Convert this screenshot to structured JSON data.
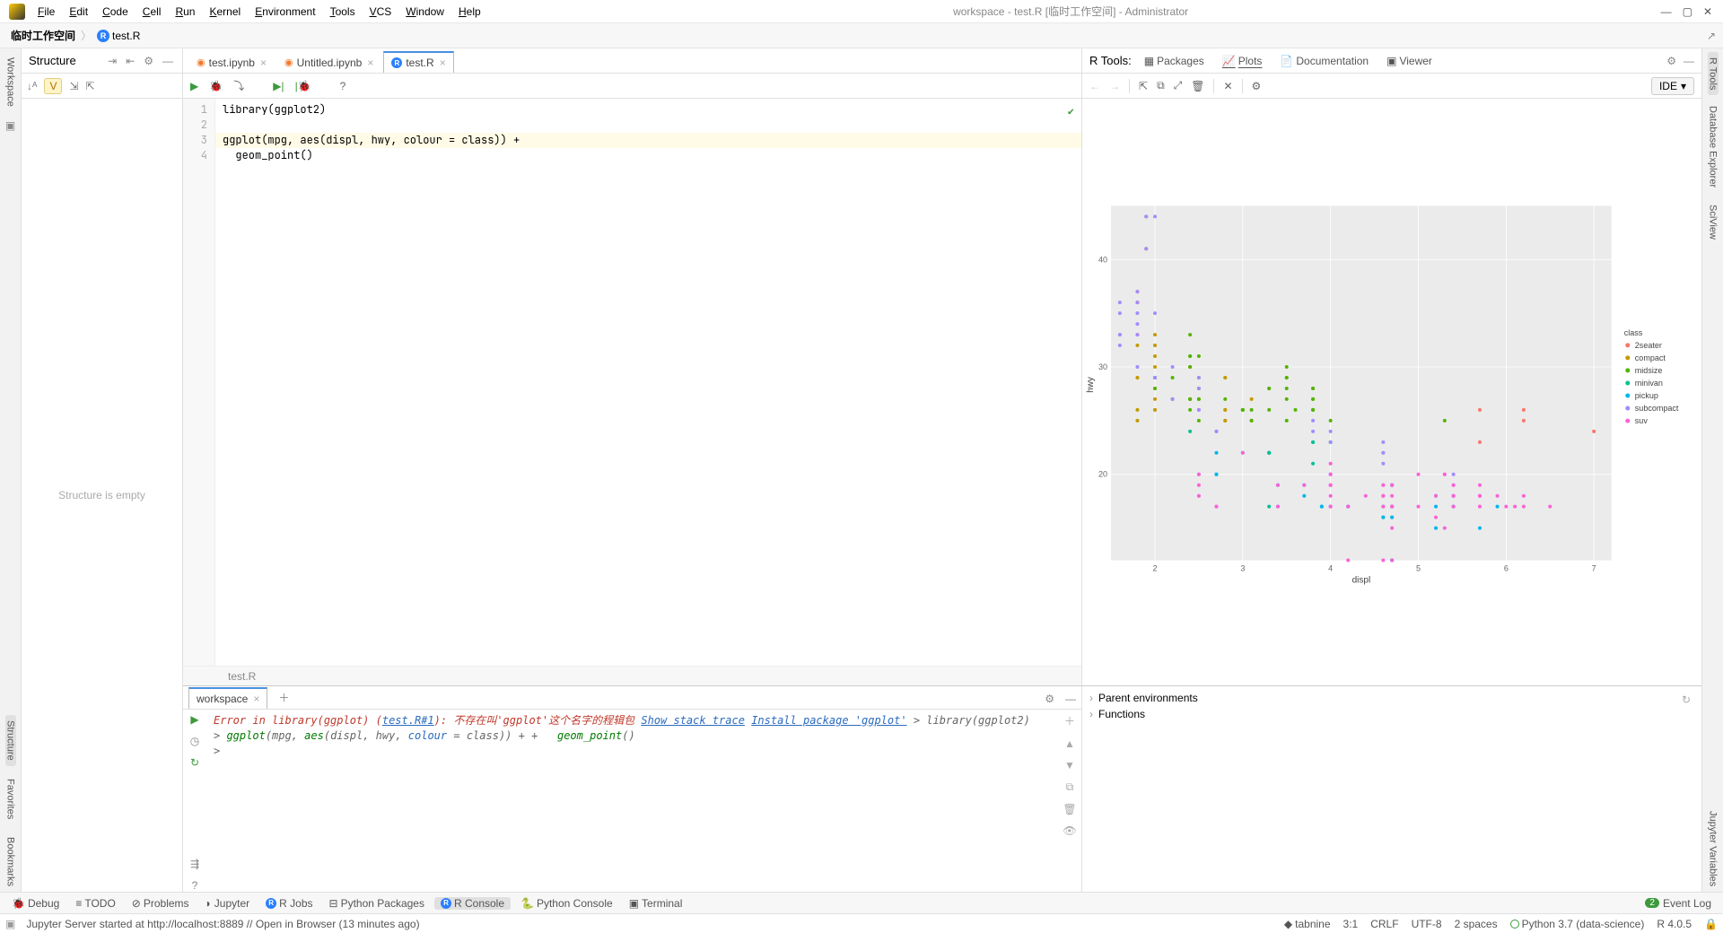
{
  "menus": [
    "File",
    "Edit",
    "Code",
    "Cell",
    "Run",
    "Kernel",
    "Environment",
    "Tools",
    "VCS",
    "Window",
    "Help"
  ],
  "window_title": "workspace - test.R [临时工作空间] - Administrator",
  "breadcrumb": {
    "root": "临时工作空间",
    "file": "test.R"
  },
  "structure": {
    "title": "Structure",
    "empty": "Structure is empty"
  },
  "left_tabs": {
    "workspace": "Workspace",
    "structure": "Structure",
    "favorites": "Favorites",
    "bookmarks": "Bookmarks"
  },
  "right_tabs": {
    "rtools": "R Tools",
    "db": "Database Explorer",
    "sciview": "SciView",
    "jupvars": "Jupyter Variables"
  },
  "editor_tabs": [
    {
      "label": "test.ipynb",
      "type": "jup"
    },
    {
      "label": "Untitled.ipynb",
      "type": "jup"
    },
    {
      "label": "test.R",
      "type": "r",
      "active": true
    }
  ],
  "code": {
    "l1": "library(ggplot2)",
    "l3": "ggplot(mpg, aes(displ, hwy, colour = class)) +",
    "l4": "  geom_point()"
  },
  "editor_path": "test.R",
  "rtools": {
    "label": "R Tools:",
    "tabs": [
      "Packages",
      "Plots",
      "Documentation",
      "Viewer"
    ],
    "ide": "IDE"
  },
  "chart_data": {
    "type": "scatter",
    "xlabel": "displ",
    "ylabel": "hwy",
    "xrange": [
      1.5,
      7.2
    ],
    "yrange": [
      12,
      45
    ],
    "xticks": [
      2,
      3,
      4,
      5,
      6,
      7
    ],
    "yticks": [
      20,
      30,
      40
    ],
    "legend_title": "class",
    "series": [
      {
        "name": "2seater",
        "color": "#F8766D",
        "points": [
          [
            5.7,
            26
          ],
          [
            5.7,
            23
          ],
          [
            6.2,
            26
          ],
          [
            6.2,
            25
          ],
          [
            7.0,
            24
          ]
        ]
      },
      {
        "name": "compact",
        "color": "#C49A00",
        "points": [
          [
            1.8,
            29
          ],
          [
            1.8,
            29
          ],
          [
            2.0,
            31
          ],
          [
            2.0,
            30
          ],
          [
            2.8,
            26
          ],
          [
            2.8,
            26
          ],
          [
            3.1,
            27
          ],
          [
            1.8,
            26
          ],
          [
            1.8,
            25
          ],
          [
            2.0,
            28
          ],
          [
            2.0,
            27
          ],
          [
            2.8,
            25
          ],
          [
            2.8,
            25
          ],
          [
            3.1,
            25
          ],
          [
            3.1,
            25
          ],
          [
            2.4,
            30
          ],
          [
            2.4,
            30
          ],
          [
            3.3,
            28
          ],
          [
            2.0,
            29
          ],
          [
            2.0,
            29
          ],
          [
            2.0,
            28
          ],
          [
            2.0,
            26
          ],
          [
            1.8,
            36
          ],
          [
            1.8,
            37
          ],
          [
            1.8,
            36
          ],
          [
            2.0,
            26
          ],
          [
            2.0,
            29
          ],
          [
            2.4,
            27
          ],
          [
            1.9,
            44
          ],
          [
            2.0,
            29
          ],
          [
            2.5,
            29
          ],
          [
            2.8,
            29
          ],
          [
            2.8,
            29
          ],
          [
            1.9,
            41
          ],
          [
            2.0,
            29
          ],
          [
            1.8,
            33
          ],
          [
            1.8,
            32
          ],
          [
            2.0,
            32
          ],
          [
            2.0,
            33
          ]
        ]
      },
      {
        "name": "midsize",
        "color": "#53B400",
        "points": [
          [
            2.4,
            27
          ],
          [
            3.1,
            25
          ],
          [
            2.5,
            27
          ],
          [
            2.5,
            25
          ],
          [
            3.5,
            25
          ],
          [
            3.0,
            26
          ],
          [
            3.5,
            29
          ],
          [
            2.8,
            27
          ],
          [
            3.3,
            26
          ],
          [
            3.5,
            28
          ],
          [
            3.8,
            26
          ],
          [
            3.8,
            28
          ],
          [
            3.8,
            27
          ],
          [
            5.3,
            25
          ],
          [
            2.2,
            27
          ],
          [
            2.2,
            29
          ],
          [
            2.4,
            31
          ],
          [
            2.4,
            31
          ],
          [
            3.0,
            26
          ],
          [
            3.3,
            28
          ],
          [
            2.4,
            26
          ],
          [
            2.4,
            27
          ],
          [
            3.8,
            26
          ],
          [
            3.8,
            26
          ],
          [
            3.8,
            27
          ],
          [
            3.8,
            28
          ],
          [
            4.0,
            25
          ],
          [
            3.6,
            26
          ],
          [
            2.4,
            30
          ],
          [
            2.4,
            33
          ],
          [
            2.5,
            28
          ],
          [
            2.5,
            31
          ],
          [
            3.5,
            30
          ],
          [
            3.5,
            27
          ],
          [
            3.0,
            26
          ],
          [
            2.0,
            28
          ],
          [
            2.0,
            29
          ],
          [
            3.1,
            26
          ],
          [
            2.5,
            27
          ],
          [
            3.5,
            29
          ],
          [
            3.0,
            26
          ]
        ]
      },
      {
        "name": "minivan",
        "color": "#00C094",
        "points": [
          [
            2.4,
            24
          ],
          [
            3.0,
            22
          ],
          [
            3.3,
            22
          ],
          [
            3.3,
            22
          ],
          [
            3.3,
            22
          ],
          [
            3.3,
            17
          ],
          [
            3.3,
            22
          ],
          [
            3.8,
            21
          ],
          [
            3.8,
            23
          ],
          [
            3.8,
            23
          ],
          [
            4.0,
            23
          ]
        ]
      },
      {
        "name": "pickup",
        "color": "#00B6EB",
        "points": [
          [
            3.7,
            19
          ],
          [
            3.7,
            18
          ],
          [
            3.9,
            17
          ],
          [
            3.9,
            17
          ],
          [
            4.7,
            19
          ],
          [
            4.7,
            19
          ],
          [
            4.7,
            12
          ],
          [
            5.2,
            17
          ],
          [
            5.2,
            15
          ],
          [
            3.9,
            17
          ],
          [
            4.7,
            12
          ],
          [
            4.7,
            17
          ],
          [
            4.7,
            16
          ],
          [
            5.2,
            18
          ],
          [
            5.7,
            15
          ],
          [
            5.9,
            17
          ],
          [
            4.7,
            16
          ],
          [
            4.7,
            12
          ],
          [
            4.7,
            17
          ],
          [
            4.2,
            17
          ],
          [
            4.2,
            17
          ],
          [
            4.6,
            16
          ],
          [
            4.6,
            16
          ],
          [
            4.6,
            17
          ],
          [
            5.4,
            17
          ],
          [
            5.4,
            18
          ],
          [
            5.4,
            17
          ],
          [
            2.7,
            20
          ],
          [
            2.7,
            20
          ],
          [
            2.7,
            22
          ],
          [
            3.4,
            17
          ],
          [
            3.4,
            19
          ],
          [
            4.0,
            20
          ],
          [
            4.0,
            17
          ]
        ]
      },
      {
        "name": "subcompact",
        "color": "#A58AFF",
        "points": [
          [
            3.8,
            25
          ],
          [
            3.8,
            24
          ],
          [
            4.0,
            23
          ],
          [
            4.0,
            24
          ],
          [
            4.6,
            21
          ],
          [
            4.6,
            22
          ],
          [
            4.6,
            23
          ],
          [
            4.6,
            22
          ],
          [
            5.4,
            20
          ],
          [
            1.6,
            33
          ],
          [
            1.6,
            32
          ],
          [
            1.6,
            36
          ],
          [
            1.6,
            35
          ],
          [
            1.8,
            34
          ],
          [
            1.8,
            36
          ],
          [
            1.8,
            35
          ],
          [
            1.8,
            37
          ],
          [
            2.0,
            44
          ],
          [
            2.0,
            29
          ],
          [
            2.5,
            26
          ],
          [
            2.2,
            27
          ],
          [
            2.2,
            30
          ],
          [
            2.5,
            26
          ],
          [
            2.5,
            29
          ],
          [
            2.5,
            28
          ],
          [
            2.7,
            24
          ],
          [
            2.7,
            24
          ],
          [
            1.8,
            30
          ],
          [
            1.8,
            33
          ],
          [
            2.0,
            35
          ],
          [
            1.9,
            44
          ],
          [
            1.9,
            41
          ],
          [
            2.0,
            29
          ],
          [
            3.4,
            17
          ],
          [
            1.6,
            33
          ]
        ]
      },
      {
        "name": "suv",
        "color": "#FB61D7",
        "points": [
          [
            5.3,
            20
          ],
          [
            5.3,
            15
          ],
          [
            5.3,
            20
          ],
          [
            5.7,
            17
          ],
          [
            6.0,
            17
          ],
          [
            5.7,
            18
          ],
          [
            5.7,
            17
          ],
          [
            6.2,
            18
          ],
          [
            6.2,
            17
          ],
          [
            6.5,
            17
          ],
          [
            4.2,
            17
          ],
          [
            4.2,
            17
          ],
          [
            4.6,
            18
          ],
          [
            4.6,
            18
          ],
          [
            4.6,
            17
          ],
          [
            5.4,
            17
          ],
          [
            5.4,
            18
          ],
          [
            6.1,
            17
          ],
          [
            4.0,
            17
          ],
          [
            4.0,
            19
          ],
          [
            4.0,
            18
          ],
          [
            4.0,
            21
          ],
          [
            4.0,
            19
          ],
          [
            4.6,
            19
          ],
          [
            5.0,
            17
          ],
          [
            4.2,
            12
          ],
          [
            4.4,
            18
          ],
          [
            4.6,
            18
          ],
          [
            5.4,
            19
          ],
          [
            5.4,
            19
          ],
          [
            2.5,
            18
          ],
          [
            2.5,
            18
          ],
          [
            2.5,
            20
          ],
          [
            2.5,
            19
          ],
          [
            2.5,
            20
          ],
          [
            2.7,
            17
          ],
          [
            2.7,
            17
          ],
          [
            3.4,
            19
          ],
          [
            3.4,
            17
          ],
          [
            4.0,
            20
          ],
          [
            4.7,
            17
          ],
          [
            4.7,
            15
          ],
          [
            4.7,
            18
          ],
          [
            4.7,
            17
          ],
          [
            4.7,
            19
          ],
          [
            5.7,
            18
          ],
          [
            5.7,
            19
          ],
          [
            3.0,
            22
          ],
          [
            3.7,
            19
          ],
          [
            4.0,
            20
          ],
          [
            4.7,
            17
          ],
          [
            4.7,
            12
          ],
          [
            4.7,
            19
          ],
          [
            5.2,
            18
          ],
          [
            5.2,
            16
          ],
          [
            5.7,
            18
          ],
          [
            5.9,
            18
          ],
          [
            4.6,
            12
          ],
          [
            5.4,
            18
          ],
          [
            5.4,
            18
          ],
          [
            4.0,
            17
          ],
          [
            4.0,
            19
          ],
          [
            4.6,
            19
          ],
          [
            5.0,
            20
          ]
        ]
      }
    ]
  },
  "console": {
    "tab": "workspace",
    "error_prefix": "Error in library(ggplot) (",
    "error_link": "test.R#1",
    "error_suffix": "): 不存在叫'ggplot'这个名字的程辑包",
    "show_stack": "Show stack trace",
    "install": "Install package 'ggplot'",
    "cmd1": "> library(ggplot2)",
    "cmd2": "> ggplot(mpg, aes(displ, hwy, colour = class)) +",
    "cmd3": "+   geom_point()",
    "prompt": ">"
  },
  "env": {
    "parent": "Parent environments",
    "functions": "Functions"
  },
  "bottom_tabs": {
    "debug": "Debug",
    "todo": "TODO",
    "problems": "Problems",
    "jupyter": "Jupyter",
    "rjobs": "R Jobs",
    "pypkg": "Python Packages",
    "rconsole": "R Console",
    "pyconsole": "Python Console",
    "terminal": "Terminal",
    "eventlog": "Event Log",
    "event_count": "2"
  },
  "status": {
    "msg": "Jupyter Server started at http://localhost:8889 // Open in Browser (13 minutes ago)",
    "tabnine": "tabnine",
    "pos": "3:1",
    "lf": "CRLF",
    "enc": "UTF-8",
    "indent": "2 spaces",
    "python": "Python 3.7 (data-science)",
    "r": "R 4.0.5"
  }
}
